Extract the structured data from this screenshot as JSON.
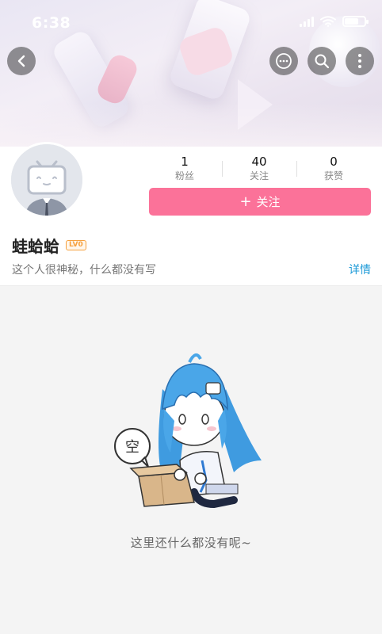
{
  "status_bar": {
    "time": "6:38",
    "battery_level": 0.65
  },
  "nav": {
    "back_icon": "chevron-left-icon",
    "message_icon": "chat-bubble-icon",
    "search_icon": "search-icon",
    "more_icon": "more-vertical-icon"
  },
  "profile": {
    "stats": [
      {
        "value": "1",
        "label": "粉丝"
      },
      {
        "value": "40",
        "label": "关注"
      },
      {
        "value": "0",
        "label": "获赞"
      }
    ],
    "follow_button": {
      "icon": "+",
      "label": "关注"
    },
    "name": "蛙蛤蛤",
    "level_badge": "LV0",
    "bio": "这个人很神秘，什么都没有写",
    "detail_link": "详情"
  },
  "empty_state": {
    "bubble_text": "空",
    "message": "这里还什么都没有呢~"
  },
  "colors": {
    "accent_pink": "#fb7299",
    "link_blue": "#1e9bd8",
    "level_orange": "#f6a03d",
    "mascot_blue": "#4aa6e8"
  }
}
